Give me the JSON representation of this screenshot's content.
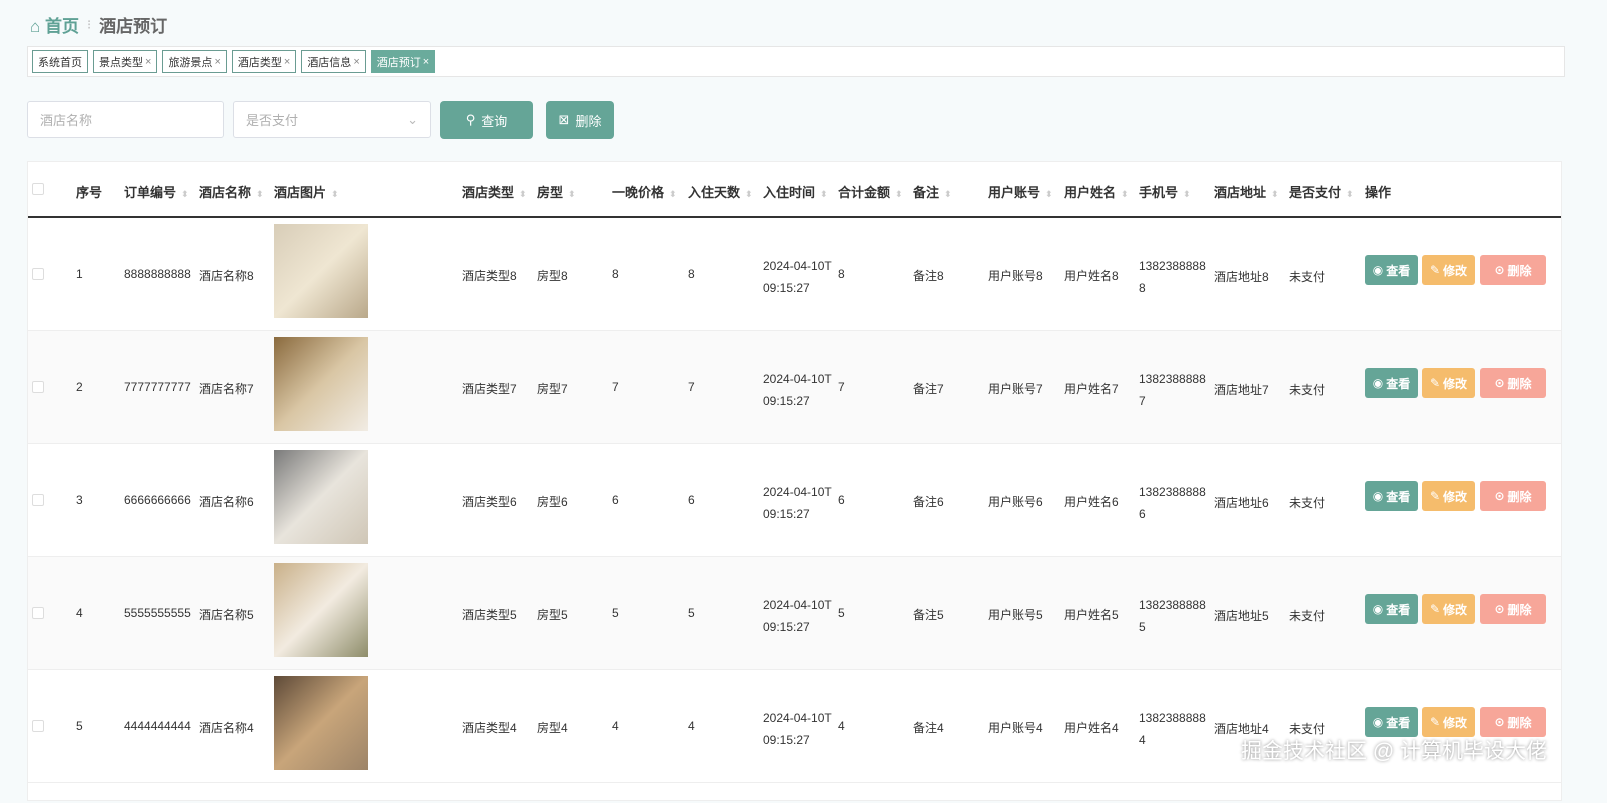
{
  "breadcrumb": {
    "home": "首页",
    "current": "酒店预订"
  },
  "tabs": [
    {
      "label": "系统首页",
      "closable": false
    },
    {
      "label": "景点类型",
      "closable": true
    },
    {
      "label": "旅游景点",
      "closable": true
    },
    {
      "label": "酒店类型",
      "closable": true
    },
    {
      "label": "酒店信息",
      "closable": true
    },
    {
      "label": "酒店预订",
      "closable": true,
      "active": true
    }
  ],
  "search": {
    "name_placeholder": "酒店名称",
    "pay_placeholder": "是否支付",
    "query_label": "查询",
    "delete_label": "删除"
  },
  "columns": [
    "序号",
    "订单编号",
    "酒店名称",
    "酒店图片",
    "酒店类型",
    "房型",
    "一晚价格",
    "入住天数",
    "入住时间",
    "合计金额",
    "备注",
    "用户账号",
    "用户姓名",
    "手机号",
    "酒店地址",
    "是否支付",
    "操作"
  ],
  "actions": {
    "view": "查看",
    "edit": "修改",
    "delete": "删除"
  },
  "rows": [
    {
      "index": "1",
      "order": "8888888888",
      "name": "酒店名称8",
      "type": "酒店类型8",
      "room": "房型8",
      "price": "8",
      "days": "8",
      "date": "2024-04-10T",
      "time": "09:15:27",
      "total": "8",
      "note": "备注8",
      "account": "用户账号8",
      "username": "用户姓名8",
      "phone1": "1382388888",
      "phone2": "8",
      "address": "酒店地址8",
      "paid": "未支付"
    },
    {
      "index": "2",
      "order": "7777777777",
      "name": "酒店名称7",
      "type": "酒店类型7",
      "room": "房型7",
      "price": "7",
      "days": "7",
      "date": "2024-04-10T",
      "time": "09:15:27",
      "total": "7",
      "note": "备注7",
      "account": "用户账号7",
      "username": "用户姓名7",
      "phone1": "1382388888",
      "phone2": "7",
      "address": "酒店地址7",
      "paid": "未支付"
    },
    {
      "index": "3",
      "order": "6666666666",
      "name": "酒店名称6",
      "type": "酒店类型6",
      "room": "房型6",
      "price": "6",
      "days": "6",
      "date": "2024-04-10T",
      "time": "09:15:27",
      "total": "6",
      "note": "备注6",
      "account": "用户账号6",
      "username": "用户姓名6",
      "phone1": "1382388888",
      "phone2": "6",
      "address": "酒店地址6",
      "paid": "未支付"
    },
    {
      "index": "4",
      "order": "5555555555",
      "name": "酒店名称5",
      "type": "酒店类型5",
      "room": "房型5",
      "price": "5",
      "days": "5",
      "date": "2024-04-10T",
      "time": "09:15:27",
      "total": "5",
      "note": "备注5",
      "account": "用户账号5",
      "username": "用户姓名5",
      "phone1": "1382388888",
      "phone2": "5",
      "address": "酒店地址5",
      "paid": "未支付"
    },
    {
      "index": "5",
      "order": "4444444444",
      "name": "酒店名称4",
      "type": "酒店类型4",
      "room": "房型4",
      "price": "4",
      "days": "4",
      "date": "2024-04-10T",
      "time": "09:15:27",
      "total": "4",
      "note": "备注4",
      "account": "用户账号4",
      "username": "用户姓名4",
      "phone1": "1382388888",
      "phone2": "4",
      "address": "酒店地址4",
      "paid": "未支付"
    }
  ],
  "watermark": "掘金技术社区 @ 计算机毕设大佬",
  "colors": {
    "primary": "#65a597",
    "edit": "#f5bc6c",
    "delete": "#f7a699"
  }
}
